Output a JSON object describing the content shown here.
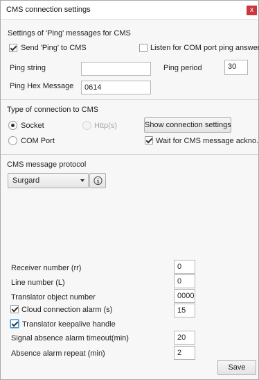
{
  "window": {
    "title": "CMS connection settings",
    "close_label": "x"
  },
  "ping": {
    "section_title": "Settings of 'Ping' messages for CMS",
    "send_ping_label": "Send 'Ping' to CMS",
    "send_ping_checked": true,
    "listen_com_label": "Listen for COM port ping answer",
    "listen_com_checked": false,
    "ping_string_label": "Ping string",
    "ping_string_value": "",
    "ping_period_label": "Ping period",
    "ping_period_value": "30",
    "ping_hex_label": "Ping Hex Message",
    "ping_hex_value": "0614"
  },
  "connection": {
    "section_title": "Type of connection to CMS",
    "socket_label": "Socket",
    "socket_selected": true,
    "http_label": "Http(s)",
    "http_enabled": false,
    "com_port_label": "COM Port",
    "com_port_selected": false,
    "show_settings_label": "Show connection settings",
    "wait_ack_label": "Wait for CMS message ackno...",
    "wait_ack_checked": true
  },
  "protocol": {
    "section_title": "CMS message protocol",
    "selected": "Surgard",
    "info_icon": "info-circle-icon"
  },
  "fields": {
    "receiver_label": "Receiver number (rr)",
    "receiver_value": "0",
    "line_label": "Line number (L)",
    "line_value": "0",
    "translator_obj_label": "Translator object number",
    "translator_obj_value": "0000",
    "cloud_alarm_label": "Cloud connection alarm (s)",
    "cloud_alarm_checked": true,
    "cloud_alarm_value": "15",
    "keepalive_label": "Translator keepalive handle",
    "keepalive_checked": true,
    "signal_absence_label": "Signal absence alarm timeout(min)",
    "signal_absence_value": "20",
    "absence_repeat_label": "Absence alarm repeat (min)",
    "absence_repeat_value": "2"
  },
  "footer": {
    "save_label": "Save"
  },
  "colors": {
    "close_button": "#c8383c",
    "focus_border": "#3a8fd6",
    "window_bg": "#f7f7f7"
  }
}
